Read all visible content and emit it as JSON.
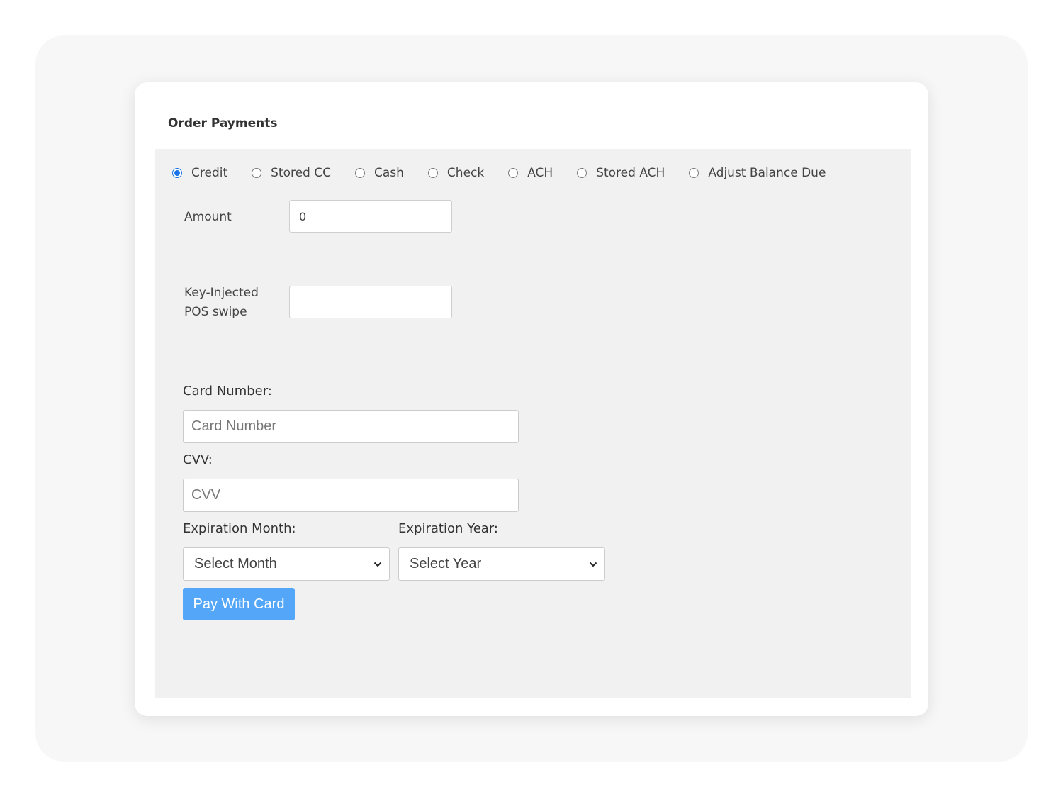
{
  "page_title": "Order Payments",
  "payment_methods": [
    {
      "label": "Credit",
      "checked": true
    },
    {
      "label": "Stored CC",
      "checked": false
    },
    {
      "label": "Cash",
      "checked": false
    },
    {
      "label": "Check",
      "checked": false
    },
    {
      "label": "ACH",
      "checked": false
    },
    {
      "label": "Stored ACH",
      "checked": false
    },
    {
      "label": "Adjust Balance Due",
      "checked": false
    }
  ],
  "amount": {
    "label": "Amount",
    "value": "0"
  },
  "pos_swipe": {
    "label_line1": "Key-Injected",
    "label_line2": "POS swipe",
    "value": ""
  },
  "card_number": {
    "label": "Card Number:",
    "placeholder": "Card Number"
  },
  "cvv": {
    "label": "CVV:",
    "placeholder": "CVV"
  },
  "exp_month": {
    "label": "Expiration Month:",
    "selected": "Select Month"
  },
  "exp_year": {
    "label": "Expiration Year:",
    "selected": "Select Year"
  },
  "pay_button": {
    "label": "Pay With Card"
  },
  "colors": {
    "accent": "#1a73e8",
    "button": "#54a7f8",
    "panel": "#f1f1f1"
  },
  "icons": {
    "select_arrow": "chevron-down-icon"
  }
}
